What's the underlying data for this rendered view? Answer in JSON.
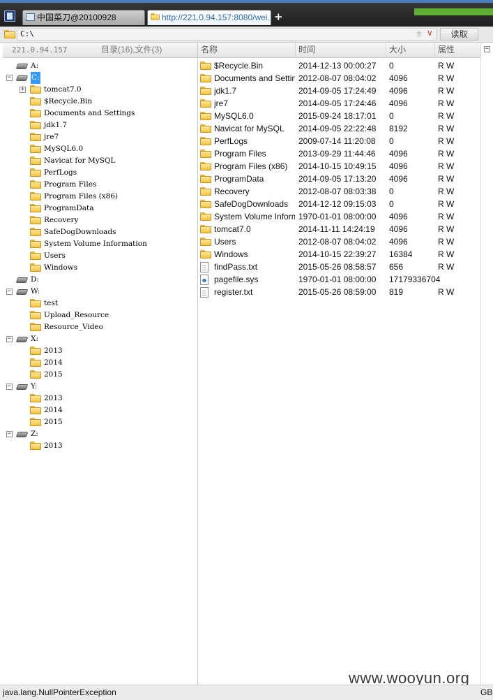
{
  "tabs": [
    {
      "label": "中国菜刀@20100928",
      "active": false
    },
    {
      "label": "http://221.0.94.157:8080/wei...",
      "active": true
    }
  ],
  "new_tab_label": "+",
  "address": {
    "path": "C:\\",
    "stepper_glyph": "±",
    "dropdown_glyph": "∨",
    "read_button": "读取"
  },
  "tree": {
    "server_address": "221.0.94.157",
    "stats": "目录(16),文件(3)",
    "nodes": [
      {
        "label": "A:",
        "type": "drive",
        "toggle": ""
      },
      {
        "label": "C:",
        "type": "drive",
        "toggle": "−",
        "selected": true
      },
      {
        "label": "tomcat7.0",
        "type": "folder",
        "toggle": "+"
      },
      {
        "label": "$Recycle.Bin",
        "type": "folder",
        "toggle": ""
      },
      {
        "label": "Documents and Settings",
        "type": "folder",
        "toggle": ""
      },
      {
        "label": "jdk1.7",
        "type": "folder",
        "toggle": ""
      },
      {
        "label": "jre7",
        "type": "folder",
        "toggle": ""
      },
      {
        "label": "MySQL6.0",
        "type": "folder",
        "toggle": ""
      },
      {
        "label": "Navicat for MySQL",
        "type": "folder",
        "toggle": ""
      },
      {
        "label": "PerfLogs",
        "type": "folder",
        "toggle": ""
      },
      {
        "label": "Program Files",
        "type": "folder",
        "toggle": ""
      },
      {
        "label": "Program Files (x86)",
        "type": "folder",
        "toggle": ""
      },
      {
        "label": "ProgramData",
        "type": "folder",
        "toggle": ""
      },
      {
        "label": "Recovery",
        "type": "folder",
        "toggle": ""
      },
      {
        "label": "SafeDogDownloads",
        "type": "folder",
        "toggle": ""
      },
      {
        "label": "System Volume Information",
        "type": "folder",
        "toggle": ""
      },
      {
        "label": "Users",
        "type": "folder",
        "toggle": ""
      },
      {
        "label": "Windows",
        "type": "folder",
        "toggle": ""
      },
      {
        "label": "D:",
        "type": "drive",
        "toggle": ""
      },
      {
        "label": "W:",
        "type": "drive",
        "toggle": "−"
      },
      {
        "label": "test",
        "type": "folder",
        "toggle": ""
      },
      {
        "label": "Upload_Resource",
        "type": "folder",
        "toggle": ""
      },
      {
        "label": "Resource_Video",
        "type": "folder",
        "toggle": ""
      },
      {
        "label": "X:",
        "type": "drive",
        "toggle": "−"
      },
      {
        "label": "2013",
        "type": "folder",
        "toggle": ""
      },
      {
        "label": "2014",
        "type": "folder",
        "toggle": ""
      },
      {
        "label": "2015",
        "type": "folder",
        "toggle": ""
      },
      {
        "label": "Y:",
        "type": "drive",
        "toggle": "−"
      },
      {
        "label": "2013",
        "type": "folder",
        "toggle": ""
      },
      {
        "label": "2014",
        "type": "folder",
        "toggle": ""
      },
      {
        "label": "2015",
        "type": "folder",
        "toggle": ""
      },
      {
        "label": "Z:",
        "type": "drive",
        "toggle": "−"
      },
      {
        "label": "2013",
        "type": "folder",
        "toggle": ""
      }
    ]
  },
  "list": {
    "columns": {
      "name": "名称",
      "time": "时间",
      "size": "大小",
      "attr": "属性"
    },
    "rows": [
      {
        "name": "$Recycle.Bin",
        "time": "2014-12-13 00:00:27",
        "size": "0",
        "attr": "R W",
        "type": "folder"
      },
      {
        "name": "Documents and Settings",
        "time": "2012-08-07 08:04:02",
        "size": "4096",
        "attr": "R W",
        "type": "folder"
      },
      {
        "name": "jdk1.7",
        "time": "2014-09-05 17:24:49",
        "size": "4096",
        "attr": "R W",
        "type": "folder"
      },
      {
        "name": "jre7",
        "time": "2014-09-05 17:24:46",
        "size": "4096",
        "attr": "R W",
        "type": "folder"
      },
      {
        "name": "MySQL6.0",
        "time": "2015-09-24 18:17:01",
        "size": "0",
        "attr": "R W",
        "type": "folder"
      },
      {
        "name": "Navicat for MySQL",
        "time": "2014-09-05 22:22:48",
        "size": "8192",
        "attr": "R W",
        "type": "folder"
      },
      {
        "name": "PerfLogs",
        "time": "2009-07-14 11:20:08",
        "size": "0",
        "attr": "R W",
        "type": "folder"
      },
      {
        "name": "Program Files",
        "time": "2013-09-29 11:44:46",
        "size": "4096",
        "attr": "R W",
        "type": "folder"
      },
      {
        "name": "Program Files (x86)",
        "time": "2014-10-15 10:49:15",
        "size": "4096",
        "attr": "R W",
        "type": "folder"
      },
      {
        "name": "ProgramData",
        "time": "2014-09-05 17:13:20",
        "size": "4096",
        "attr": "R W",
        "type": "folder"
      },
      {
        "name": "Recovery",
        "time": "2012-08-07 08:03:38",
        "size": "0",
        "attr": "R W",
        "type": "folder"
      },
      {
        "name": "SafeDogDownloads",
        "time": "2014-12-12 09:15:03",
        "size": "0",
        "attr": "R W",
        "type": "folder"
      },
      {
        "name": "System Volume Inform...",
        "time": "1970-01-01 08:00:00",
        "size": "4096",
        "attr": "R W",
        "type": "folder"
      },
      {
        "name": "tomcat7.0",
        "time": "2014-11-11 14:24:19",
        "size": "4096",
        "attr": "R W",
        "type": "folder"
      },
      {
        "name": "Users",
        "time": "2012-08-07 08:04:02",
        "size": "4096",
        "attr": "R W",
        "type": "folder"
      },
      {
        "name": "Windows",
        "time": "2014-10-15 22:39:27",
        "size": "16384",
        "attr": "R W",
        "type": "folder"
      },
      {
        "name": "findPass.txt",
        "time": "2015-05-26 08:58:57",
        "size": "656",
        "attr": "R W",
        "type": "txt"
      },
      {
        "name": "pagefile.sys",
        "time": "1970-01-01 08:00:00",
        "size": "17179336704",
        "attr": "",
        "type": "sys"
      },
      {
        "name": "register.txt",
        "time": "2015-05-26 08:59:00",
        "size": "819",
        "attr": "R W",
        "type": "txt"
      }
    ]
  },
  "side_toggle": "−",
  "status": {
    "message": "java.lang.NullPointerException",
    "encoding": "GB"
  },
  "watermark": "www.wooyun.org",
  "colors": {
    "selection": "#3399ff",
    "tab_active_text": "#2e6bb5",
    "progress": "#5fb032",
    "folder": "#f2c443"
  }
}
